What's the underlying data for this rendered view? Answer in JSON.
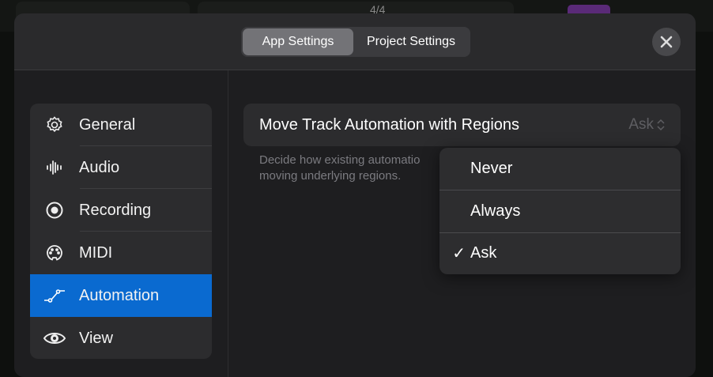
{
  "background": {
    "time_signature": "4/4"
  },
  "header": {
    "tabs": [
      {
        "label": "App Settings",
        "active": true
      },
      {
        "label": "Project Settings",
        "active": false
      }
    ],
    "close_icon": "xmark-icon"
  },
  "sidebar": {
    "items": [
      {
        "label": "General",
        "icon": "gear-icon"
      },
      {
        "label": "Audio",
        "icon": "waveform-icon"
      },
      {
        "label": "Recording",
        "icon": "record-icon"
      },
      {
        "label": "MIDI",
        "icon": "midi-icon"
      },
      {
        "label": "Automation",
        "icon": "automation-icon",
        "selected": true
      },
      {
        "label": "View",
        "icon": "eye-icon"
      }
    ]
  },
  "setting": {
    "title": "Move Track Automation with Regions",
    "value": "Ask",
    "description_line1": "Decide how existing automatio",
    "description_line2": "moving underlying regions."
  },
  "dropdown": {
    "options": [
      {
        "label": "Never",
        "checked": false
      },
      {
        "label": "Always",
        "checked": false
      },
      {
        "label": "Ask",
        "checked": true
      }
    ],
    "check": "✓"
  },
  "colors": {
    "accent": "#0a6ad0",
    "panel": "#2c2c2e"
  }
}
